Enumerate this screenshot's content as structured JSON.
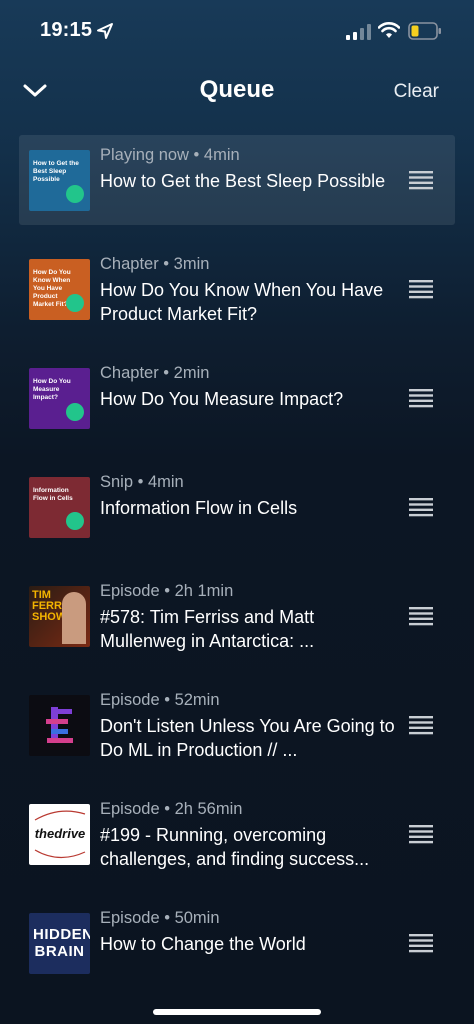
{
  "status_bar": {
    "time": "19:15"
  },
  "header": {
    "title": "Queue",
    "clear_label": "Clear"
  },
  "colors": {
    "accent": "#22c58b",
    "meta_text": "#a7b0ba"
  },
  "queue": [
    {
      "meta": "Playing now • 4min",
      "title": "How to Get the Best Sleep Possible",
      "thumb_text": "How to Get the Best Sleep Possible",
      "thumb_color": "#1f6a99",
      "playing": true
    },
    {
      "meta": "Chapter • 3min",
      "title": "How Do You Know When You Have Product Market Fit?",
      "thumb_text": "How Do You Know When You Have Product Market Fit?",
      "thumb_color": "#c95f22"
    },
    {
      "meta": "Chapter • 2min",
      "title": "How Do You Measure Impact?",
      "thumb_text": "How Do You Measure Impact?",
      "thumb_color": "#5a1f90"
    },
    {
      "meta": "Snip • 4min",
      "title": "Information Flow in Cells",
      "thumb_text": "Information Flow in Cells",
      "thumb_color": "#7d2a33"
    },
    {
      "meta": "Episode • 2h 1min",
      "title": "#578: Tim Ferriss and Matt Mullenweg in Antarctica: ...",
      "thumb_text": "TIM FERRISS SHOW",
      "thumb_color": "#1d1511"
    },
    {
      "meta": "Episode • 52min",
      "title": "Don't Listen Unless You Are Going to Do ML in Production // ...",
      "thumb_text": "",
      "thumb_color": "#0c0c12"
    },
    {
      "meta": "Episode • 2h 56min",
      "title": "#199 - Running, overcoming challenges, and finding success...",
      "thumb_text": "thedrive",
      "thumb_color": "#ffffff"
    },
    {
      "meta": "Episode • 50min",
      "title": "How to Change the World",
      "thumb_text": "HIDDEN BRAIN",
      "thumb_color": "#1c2d5e"
    }
  ]
}
